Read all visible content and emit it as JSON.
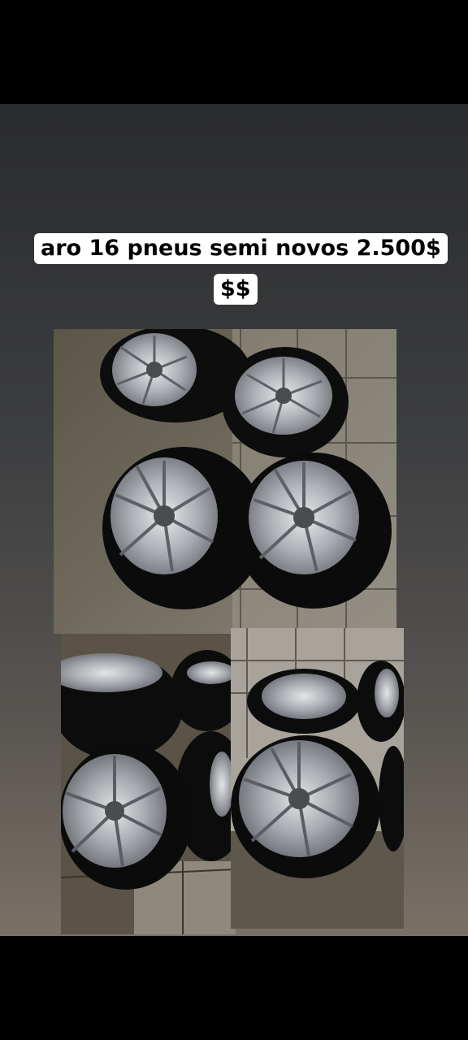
{
  "story": {
    "caption_line1": "aro 16 pneus semi novos 2.500$",
    "caption_line2": "$$"
  },
  "photos": [
    {
      "name": "tires-photo-top",
      "description_icon": "tire-wheel-image"
    },
    {
      "name": "tires-photo-bottom-left",
      "description_icon": "tire-wheel-image"
    },
    {
      "name": "tires-photo-bottom-right",
      "description_icon": "tire-wheel-image"
    }
  ]
}
